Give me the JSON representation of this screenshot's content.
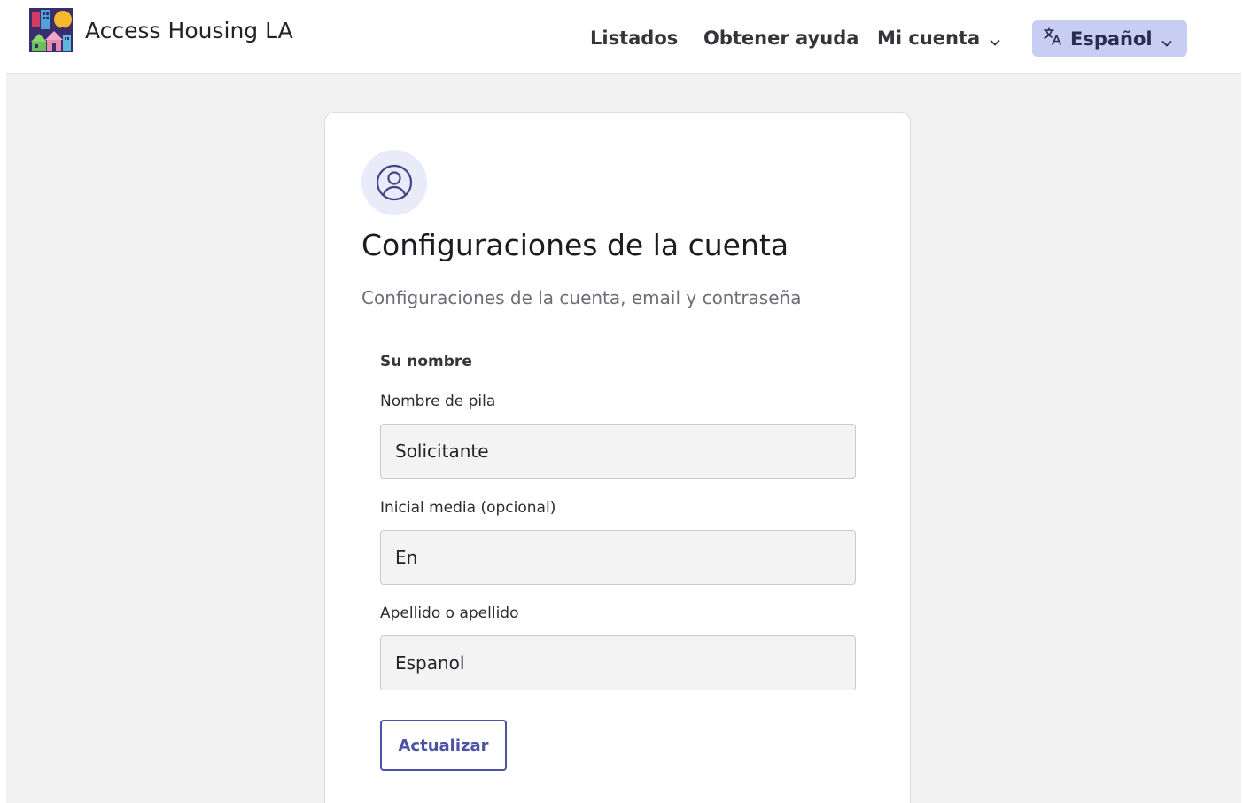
{
  "header": {
    "brand": "Access Housing LA",
    "nav": {
      "listings": "Listados",
      "help": "Obtener ayuda",
      "account": "Mi cuenta"
    },
    "language": {
      "icon": "translate-icon",
      "label": "Español"
    }
  },
  "card": {
    "icon": "user-circle-icon",
    "title": "Configuraciones de la cuenta",
    "subtitle": "Configuraciones de la cuenta, email y contraseña",
    "section_label": "Su nombre",
    "fields": [
      {
        "label": "Nombre de pila",
        "value": "Solicitante"
      },
      {
        "label": "Inicial media (opcional)",
        "value": "En"
      },
      {
        "label": "Apellido o apellido",
        "value": "Espanol"
      }
    ],
    "update_button": "Actualizar"
  },
  "colors": {
    "primary": "#4d52a6",
    "language_button_bg": "#c7cdf3",
    "page_bg": "#f1f1f2",
    "input_bg": "#f3f3f4"
  }
}
